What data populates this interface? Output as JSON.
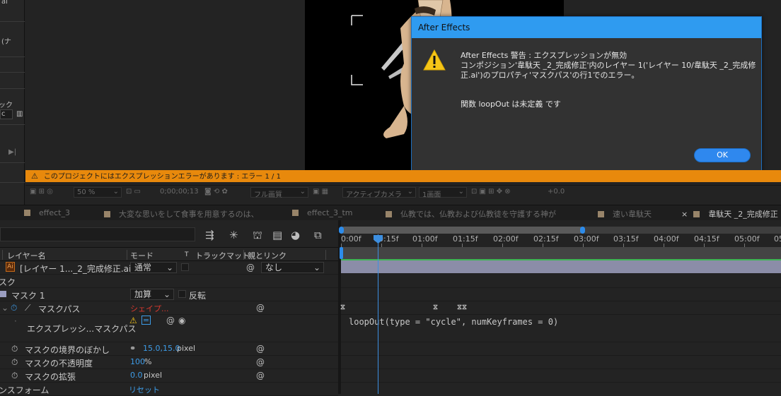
{
  "dialog": {
    "title": "After Effects",
    "line1": "After  Effects 警告 : エクスプレッションが無効",
    "line2": "コンポジション'韋駄天 _2_完成修正'内のレイヤー 1('レイヤー 10/韋駄天 _2_完成修",
    "line3": "正.ai')のプロパティ'マスクパス'の行1でのエラー。",
    "line4": "関数 loopOut は未定義 です",
    "ok": "OK"
  },
  "left_panel": {
    "frag1": "ai",
    "frag2": "(ナ",
    "frag3": "ック",
    "frag4": "c"
  },
  "warning_bar": "このプロジェクトにはエクスプレッションエラーがあります : エラー 1 / 1",
  "viewer_toolbar": {
    "zoom": "50 %",
    "timecode": "0;00;00;13",
    "quality": "フル画質",
    "camera": "アクティブカメラ",
    "views": "1画面",
    "exposure": "+0.0"
  },
  "tabs": [
    "effect_3",
    "大変な思いをして食事を用意するのは、",
    "effect_3_tm",
    "仏教では、仏教および仏教徒を守護する神が",
    "速い韋駄天",
    "韋駄天 _2_完成修正"
  ],
  "tab_close": "×",
  "columns": {
    "layer_name": "レイヤー名",
    "mode": "モード",
    "t": "T",
    "trkmat": "トラックマット",
    "parent": "親とリンク"
  },
  "layer": {
    "name": "[レイヤー 1..._2_完成修正.ai]",
    "mode": "通常",
    "parent": "なし"
  },
  "rows": {
    "mask_group_label": "スク",
    "mask1_label": "マスク 1",
    "mask1_mode": "加算",
    "invert_label": "反転",
    "maskpath_label": "マスクパス",
    "maskpath_value": "シェイプ...",
    "expr_label": "エクスプレッシ...マスクパス",
    "feather_label": "マスクの境界のぼかし",
    "feather_value": "15.0,15.0",
    "feather_unit": "pixel",
    "opacity_label": "マスクの不透明度",
    "opacity_value": "100",
    "opacity_unit": "%",
    "expansion_label": "マスクの拡張",
    "expansion_value": "0.0",
    "expansion_unit": "pixel",
    "transform_label": "ンスフォーム",
    "transform_value": "リセット"
  },
  "ruler": [
    "0:00f",
    "00:15f",
    "01:00f",
    "01:15f",
    "02:00f",
    "02:15f",
    "03:00f",
    "03:15f",
    "04:00f",
    "04:15f",
    "05:00f",
    "05"
  ],
  "expression_text": "loopOut(type = \"cycle\", numKeyframes = 0)",
  "colors": {
    "accent": "#2f9bf0",
    "warning": "#e8890c",
    "error_text": "#d9392f",
    "value_blue": "#3d9ce8"
  }
}
